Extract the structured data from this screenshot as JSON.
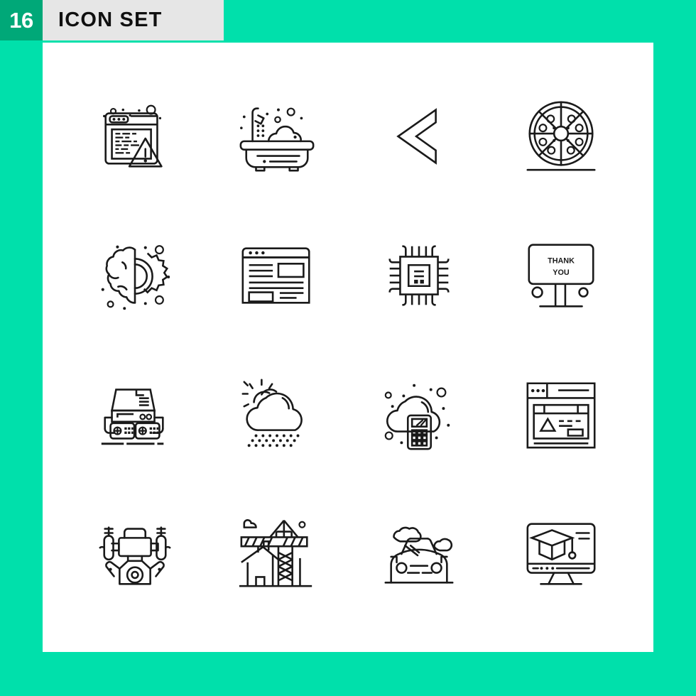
{
  "header": {
    "count": "16",
    "title": "ICON SET",
    "badge_color": "#00a878",
    "title_bg_color": "#e6e6e6",
    "title_color": "#101010"
  },
  "page": {
    "background_color": "#00e0ab",
    "panel_color": "#ffffff",
    "stroke_color": "#1a1a1a"
  },
  "grid": {
    "columns": 4,
    "rows": 4,
    "total": 16
  },
  "icons": [
    {
      "index": 1,
      "name": "web-code-error",
      "label": "browser window with code and warning triangle"
    },
    {
      "index": 2,
      "name": "bathtub",
      "label": "bathtub with shower and bubbles"
    },
    {
      "index": 3,
      "name": "chevron-left",
      "label": "left pointing chevron arrow"
    },
    {
      "index": 4,
      "name": "pizza",
      "label": "pizza sliced into eight pieces on a board"
    },
    {
      "index": 5,
      "name": "brain-gear",
      "label": "brain with gear, artificial intelligence"
    },
    {
      "index": 6,
      "name": "web-layout",
      "label": "browser window with page layout"
    },
    {
      "index": 7,
      "name": "cpu-chip",
      "label": "microprocessor chip"
    },
    {
      "index": 8,
      "name": "thank-you-board",
      "label": "billboard sign reading THANK YOU",
      "text_lines": [
        "THANK",
        "YOU"
      ]
    },
    {
      "index": 9,
      "name": "game-console",
      "label": "game console with two gamepads"
    },
    {
      "index": 10,
      "name": "sun-cloud-rain",
      "label": "sun behind cloud with drizzle"
    },
    {
      "index": 11,
      "name": "cloud-calculator",
      "label": "cloud with calculator, cloud computing"
    },
    {
      "index": 12,
      "name": "web-design",
      "label": "browser window with design canvas"
    },
    {
      "index": 13,
      "name": "drone",
      "label": "quadcopter drone with camera"
    },
    {
      "index": 14,
      "name": "construction-crane",
      "label": "tower crane with house under construction"
    },
    {
      "index": 15,
      "name": "car-front",
      "label": "car front view with clouds"
    },
    {
      "index": 16,
      "name": "online-education",
      "label": "monitor with graduation cap"
    }
  ]
}
